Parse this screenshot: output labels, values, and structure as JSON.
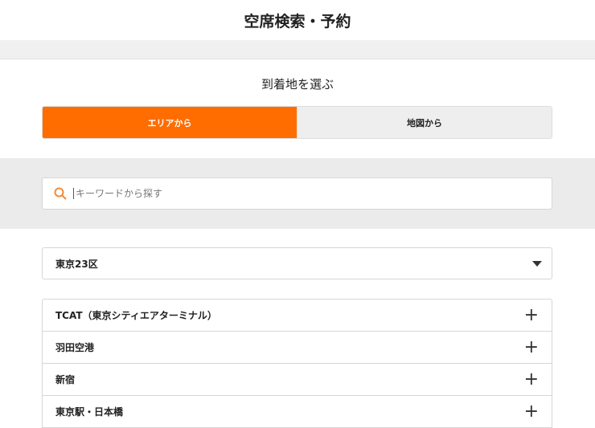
{
  "header": {
    "title": "空席検索・予約"
  },
  "section": {
    "subtitle": "到着地を選ぶ"
  },
  "tabs": [
    {
      "label": "エリアから"
    },
    {
      "label": "地図から"
    }
  ],
  "search": {
    "placeholder": "キーワードから探す"
  },
  "area_select": {
    "value": "東京23区"
  },
  "list": [
    {
      "label": "TCAT（東京シティエアターミナル）"
    },
    {
      "label": "羽田空港"
    },
    {
      "label": "新宿"
    },
    {
      "label": "東京駅・日本橋"
    }
  ],
  "colors": {
    "accent": "#ff6d00"
  }
}
